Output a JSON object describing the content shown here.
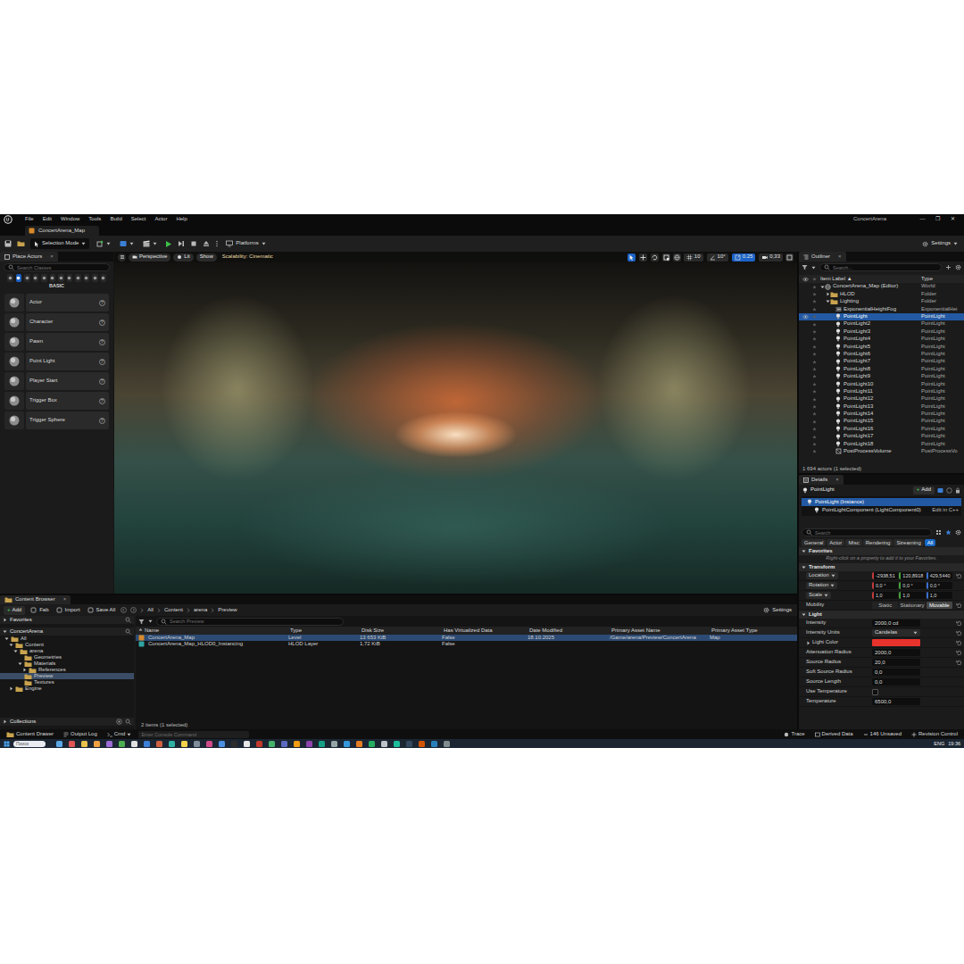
{
  "window": {
    "title": "ConcertArena",
    "controls": [
      "—",
      "❐",
      "✕"
    ]
  },
  "menu": [
    "File",
    "Edit",
    "Window",
    "Tools",
    "Build",
    "Select",
    "Actor",
    "Help"
  ],
  "level_tab": {
    "label": "ConcertArena_Map",
    "selected": true
  },
  "toolbar": {
    "mode": "Selection Mode",
    "platforms": "Platforms",
    "settings": "Settings"
  },
  "place_actors": {
    "title": "Place Actors",
    "close": "×",
    "search": {
      "placeholder": "Search Classes"
    },
    "categories": [
      {
        "selected": false
      },
      {
        "selected": true
      },
      {
        "selected": false
      },
      {
        "selected": false
      },
      {
        "selected": false
      },
      {
        "selected": false
      },
      {
        "selected": false
      },
      {
        "selected": false
      },
      {
        "selected": false
      },
      {
        "selected": false
      },
      {
        "selected": false
      },
      {
        "selected": false
      }
    ],
    "group": "BASIC",
    "help": "?",
    "items": [
      "Actor",
      "Character",
      "Pawn",
      "Point Light",
      "Player Start",
      "Trigger Box",
      "Trigger Sphere"
    ]
  },
  "viewport": {
    "view": "Perspective",
    "mode": "Lit",
    "show": "Show",
    "scalability": "Scalability: Cinematic",
    "tools": [
      {
        "selected": true
      },
      {
        "selected": false
      },
      {
        "selected": false
      },
      {
        "selected": false
      }
    ],
    "snaps": [
      {
        "value": "10",
        "on": false
      },
      {
        "value": "10°",
        "on": false
      },
      {
        "value": "0.25",
        "on": true
      },
      {
        "value": "0,33",
        "on": false
      }
    ]
  },
  "outliner": {
    "title": "Outliner",
    "close": "×",
    "search": {
      "placeholder": "Search..."
    },
    "columns": [
      "Item Label ▲",
      "Type"
    ],
    "rows": [
      {
        "label": "ConcertArena_Map (Editor)",
        "type": "World",
        "kind": "world",
        "depth": 0,
        "expanded": true,
        "selected": false
      },
      {
        "label": "HLOD",
        "type": "Folder",
        "kind": "folder",
        "depth": 1,
        "expanded": false,
        "selected": false
      },
      {
        "label": "Lighting",
        "type": "Folder",
        "kind": "folder",
        "depth": 1,
        "expanded": true,
        "selected": false
      },
      {
        "label": "ExponentialHeightFog",
        "type": "ExponentialHei",
        "kind": "fog",
        "depth": 2,
        "selected": false
      },
      {
        "label": "PointLight",
        "type": "PointLight",
        "kind": "light",
        "depth": 2,
        "selected": true
      },
      {
        "label": "PointLight2",
        "type": "PointLight",
        "kind": "light",
        "depth": 2,
        "selected": false
      },
      {
        "label": "PointLight3",
        "type": "PointLight",
        "kind": "light",
        "depth": 2,
        "selected": false
      },
      {
        "label": "PointLight4",
        "type": "PointLight",
        "kind": "light",
        "depth": 2,
        "selected": false
      },
      {
        "label": "PointLight5",
        "type": "PointLight",
        "kind": "light",
        "depth": 2,
        "selected": false
      },
      {
        "label": "PointLight6",
        "type": "PointLight",
        "kind": "light",
        "depth": 2,
        "selected": false
      },
      {
        "label": "PointLight7",
        "type": "PointLight",
        "kind": "light",
        "depth": 2,
        "selected": false
      },
      {
        "label": "PointLight8",
        "type": "PointLight",
        "kind": "light",
        "depth": 2,
        "selected": false
      },
      {
        "label": "PointLight9",
        "type": "PointLight",
        "kind": "light",
        "depth": 2,
        "selected": false
      },
      {
        "label": "PointLight10",
        "type": "PointLight",
        "kind": "light",
        "depth": 2,
        "selected": false
      },
      {
        "label": "PointLight11",
        "type": "PointLight",
        "kind": "light",
        "depth": 2,
        "selected": false
      },
      {
        "label": "PointLight12",
        "type": "PointLight",
        "kind": "light",
        "depth": 2,
        "selected": false
      },
      {
        "label": "PointLight13",
        "type": "PointLight",
        "kind": "light",
        "depth": 2,
        "selected": false
      },
      {
        "label": "PointLight14",
        "type": "PointLight",
        "kind": "light",
        "depth": 2,
        "selected": false
      },
      {
        "label": "PointLight15",
        "type": "PointLight",
        "kind": "light",
        "depth": 2,
        "selected": false
      },
      {
        "label": "PointLight16",
        "type": "PointLight",
        "kind": "light",
        "depth": 2,
        "selected": false
      },
      {
        "label": "PointLight17",
        "type": "PointLight",
        "kind": "light",
        "depth": 2,
        "selected": false
      },
      {
        "label": "PointLight18",
        "type": "PointLight",
        "kind": "light",
        "depth": 2,
        "selected": false
      },
      {
        "label": "PostProcessVolume",
        "type": "PostProcessVo",
        "kind": "volume",
        "depth": 2,
        "selected": false
      }
    ],
    "footer": "1 694 actors (1 selected)"
  },
  "details": {
    "title": "Details",
    "close": "×",
    "actor": "PointLight",
    "add": {
      "glyph": "+",
      "label": "Add"
    },
    "components": [
      {
        "label": "PointLight (Instance)",
        "selected": true,
        "depth": 0
      },
      {
        "label": "PointLightComponent (LightComponent0)",
        "selected": false,
        "depth": 1,
        "action": "Edit in C++"
      }
    ],
    "search": {
      "placeholder": "Search"
    },
    "filters": [
      {
        "label": "General",
        "selected": false
      },
      {
        "label": "Actor",
        "selected": false
      },
      {
        "label": "Misc",
        "selected": false
      },
      {
        "label": "Rendering",
        "selected": false
      },
      {
        "label": "Streaming",
        "selected": false
      },
      {
        "label": "All",
        "selected": true
      }
    ],
    "favorites": {
      "title": "Favorites",
      "expanded": true,
      "hint": "Right-click on a property to add it to your Favorites."
    },
    "transform": {
      "title": "Transform",
      "expanded": true,
      "rows": [
        {
          "label": "Location",
          "values": [
            "-2938,51",
            "120,8918",
            "429,5440"
          ],
          "resettable": true
        },
        {
          "label": "Rotation",
          "values": [
            "0,0 °",
            "0,0 °",
            "0,0 °"
          ],
          "resettable": false
        },
        {
          "label": "Scale",
          "values": [
            "1,0",
            "1,0",
            "1,0"
          ],
          "resettable": false
        }
      ],
      "mobility": {
        "label": "Mobility",
        "resettable": true,
        "options": [
          {
            "label": "Static",
            "selected": false
          },
          {
            "label": "Stationary",
            "selected": false
          },
          {
            "label": "Movable",
            "selected": true
          }
        ]
      }
    },
    "light": {
      "title": "Light",
      "expanded": true,
      "rows": [
        {
          "label": "Intensity",
          "kind": "number",
          "value": "2000,0 cd",
          "resettable": true
        },
        {
          "label": "Intensity Units",
          "kind": "dropdown",
          "value": "Candelas",
          "resettable": true
        },
        {
          "label": "Light Color",
          "kind": "color",
          "color": "#e8322c",
          "expanded": false,
          "resettable": true
        },
        {
          "label": "Attenuation Radius",
          "kind": "number",
          "value": "2000,0",
          "resettable": true
        },
        {
          "label": "Source Radius",
          "kind": "number",
          "value": "20,0",
          "resettable": true
        },
        {
          "label": "Soft Source Radius",
          "kind": "number",
          "value": "0,0",
          "resettable": false
        },
        {
          "label": "Source Length",
          "kind": "number",
          "value": "0,0",
          "resettable": false
        },
        {
          "label": "Use Temperature",
          "kind": "checkbox",
          "checked": false,
          "resettable": false
        },
        {
          "label": "Temperature",
          "kind": "number",
          "value": "6500,0",
          "resettable": false
        }
      ]
    }
  },
  "content_browser": {
    "title": "Content Browser",
    "close": "×",
    "add": {
      "glyph": "+",
      "label": "Add"
    },
    "actions": [
      "Fab",
      "Import",
      "Save All"
    ],
    "path": [
      "All",
      "Content",
      "arena",
      "Preview"
    ],
    "settings": "Settings",
    "favorites": "Favorites",
    "root": "ConcertArena",
    "tree": [
      {
        "label": "All",
        "depth": 0,
        "expanded": true,
        "selected": false
      },
      {
        "label": "Content",
        "depth": 1,
        "expanded": true,
        "selected": false
      },
      {
        "label": "arena",
        "depth": 2,
        "expanded": true,
        "selected": false
      },
      {
        "label": "Geometries",
        "depth": 3,
        "selected": false
      },
      {
        "label": "Materials",
        "depth": 3,
        "expanded": true,
        "selected": false
      },
      {
        "label": "References",
        "depth": 4,
        "expanded": false,
        "selected": false
      },
      {
        "label": "Preview",
        "depth": 3,
        "selected": true
      },
      {
        "label": "Textures",
        "depth": 3,
        "selected": false
      },
      {
        "label": "Engine",
        "depth": 1,
        "expanded": false,
        "selected": false
      }
    ],
    "collections": "Collections",
    "search": {
      "placeholder": "Search Preview"
    },
    "columns": [
      "Name",
      "Type",
      "Disk Size",
      "Has Virtualized Data",
      "Date Modified",
      "Primary Asset Name",
      "Primary Asset Type"
    ],
    "rows": [
      {
        "kind": "level",
        "selected": true,
        "cells": [
          "ConcertArena_Map",
          "Level",
          "13 653 KiB",
          "False",
          "18.10.2025",
          "/Game/arena/Preview/ConcertArena",
          "Map"
        ]
      },
      {
        "kind": "hlod",
        "selected": false,
        "cells": [
          "ConcertArena_Map_HLOD0_Instancing",
          "HLOD Layer",
          "1,72 KiB",
          "False",
          "",
          "",
          ""
        ]
      }
    ],
    "footer": "2 items (1 selected)"
  },
  "status_bar": {
    "left": [
      "Content Drawer",
      "Output Log"
    ],
    "cmd": "Cmd",
    "console": {
      "placeholder": "Enter Console Command"
    },
    "right": [
      "Trace",
      "Derived Data",
      "146 Unsaved",
      "Revision Control"
    ]
  },
  "taskbar": {
    "search": "Поиск",
    "language": "ENG",
    "time": "19:36"
  }
}
